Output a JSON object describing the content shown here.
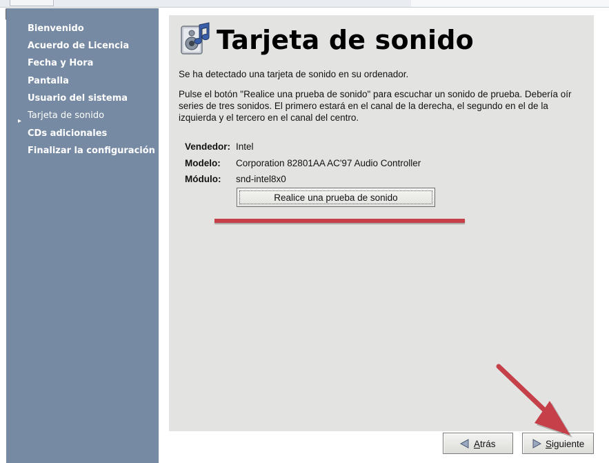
{
  "sidebar": {
    "items": [
      {
        "label": "Bienvenido"
      },
      {
        "label": "Acuerdo de Licencia"
      },
      {
        "label": "Fecha y Hora"
      },
      {
        "label": "Pantalla"
      },
      {
        "label": "Usuario del sistema"
      },
      {
        "label": "Tarjeta de sonido",
        "current": true
      },
      {
        "label": "CDs adicionales"
      },
      {
        "label": "Finalizar la configuración"
      }
    ]
  },
  "page": {
    "title": "Tarjeta de sonido",
    "icon": "sound-card-icon",
    "detected_text": "Se ha detectado una tarjeta de sonido en su ordenador.",
    "instructions": "Pulse el botón \"Realice una prueba de sonido\" para escuchar un sonido de prueba. Debería oír series de tres sonidos. El primero estará en el canal de la derecha, el segundo en el de la izquierda y el tercero en el canal del centro."
  },
  "device": {
    "vendor_label": "Vendedor:",
    "vendor_value": "Intel",
    "model_label": "Modelo:",
    "model_value": "Corporation 82801AA AC'97 Audio Controller",
    "module_label": "Módulo:",
    "module_value": "snd-intel8x0"
  },
  "test_button_label": "Realice una prueba de sonido",
  "footer": {
    "back_mnemonic": "A",
    "back_rest": "trás",
    "next_mnemonic": "S",
    "next_rest": "iguiente"
  },
  "colors": {
    "sidebar": "#778aa3",
    "content_bg": "#e3e4e1",
    "annotation_red": "#c6404a"
  }
}
